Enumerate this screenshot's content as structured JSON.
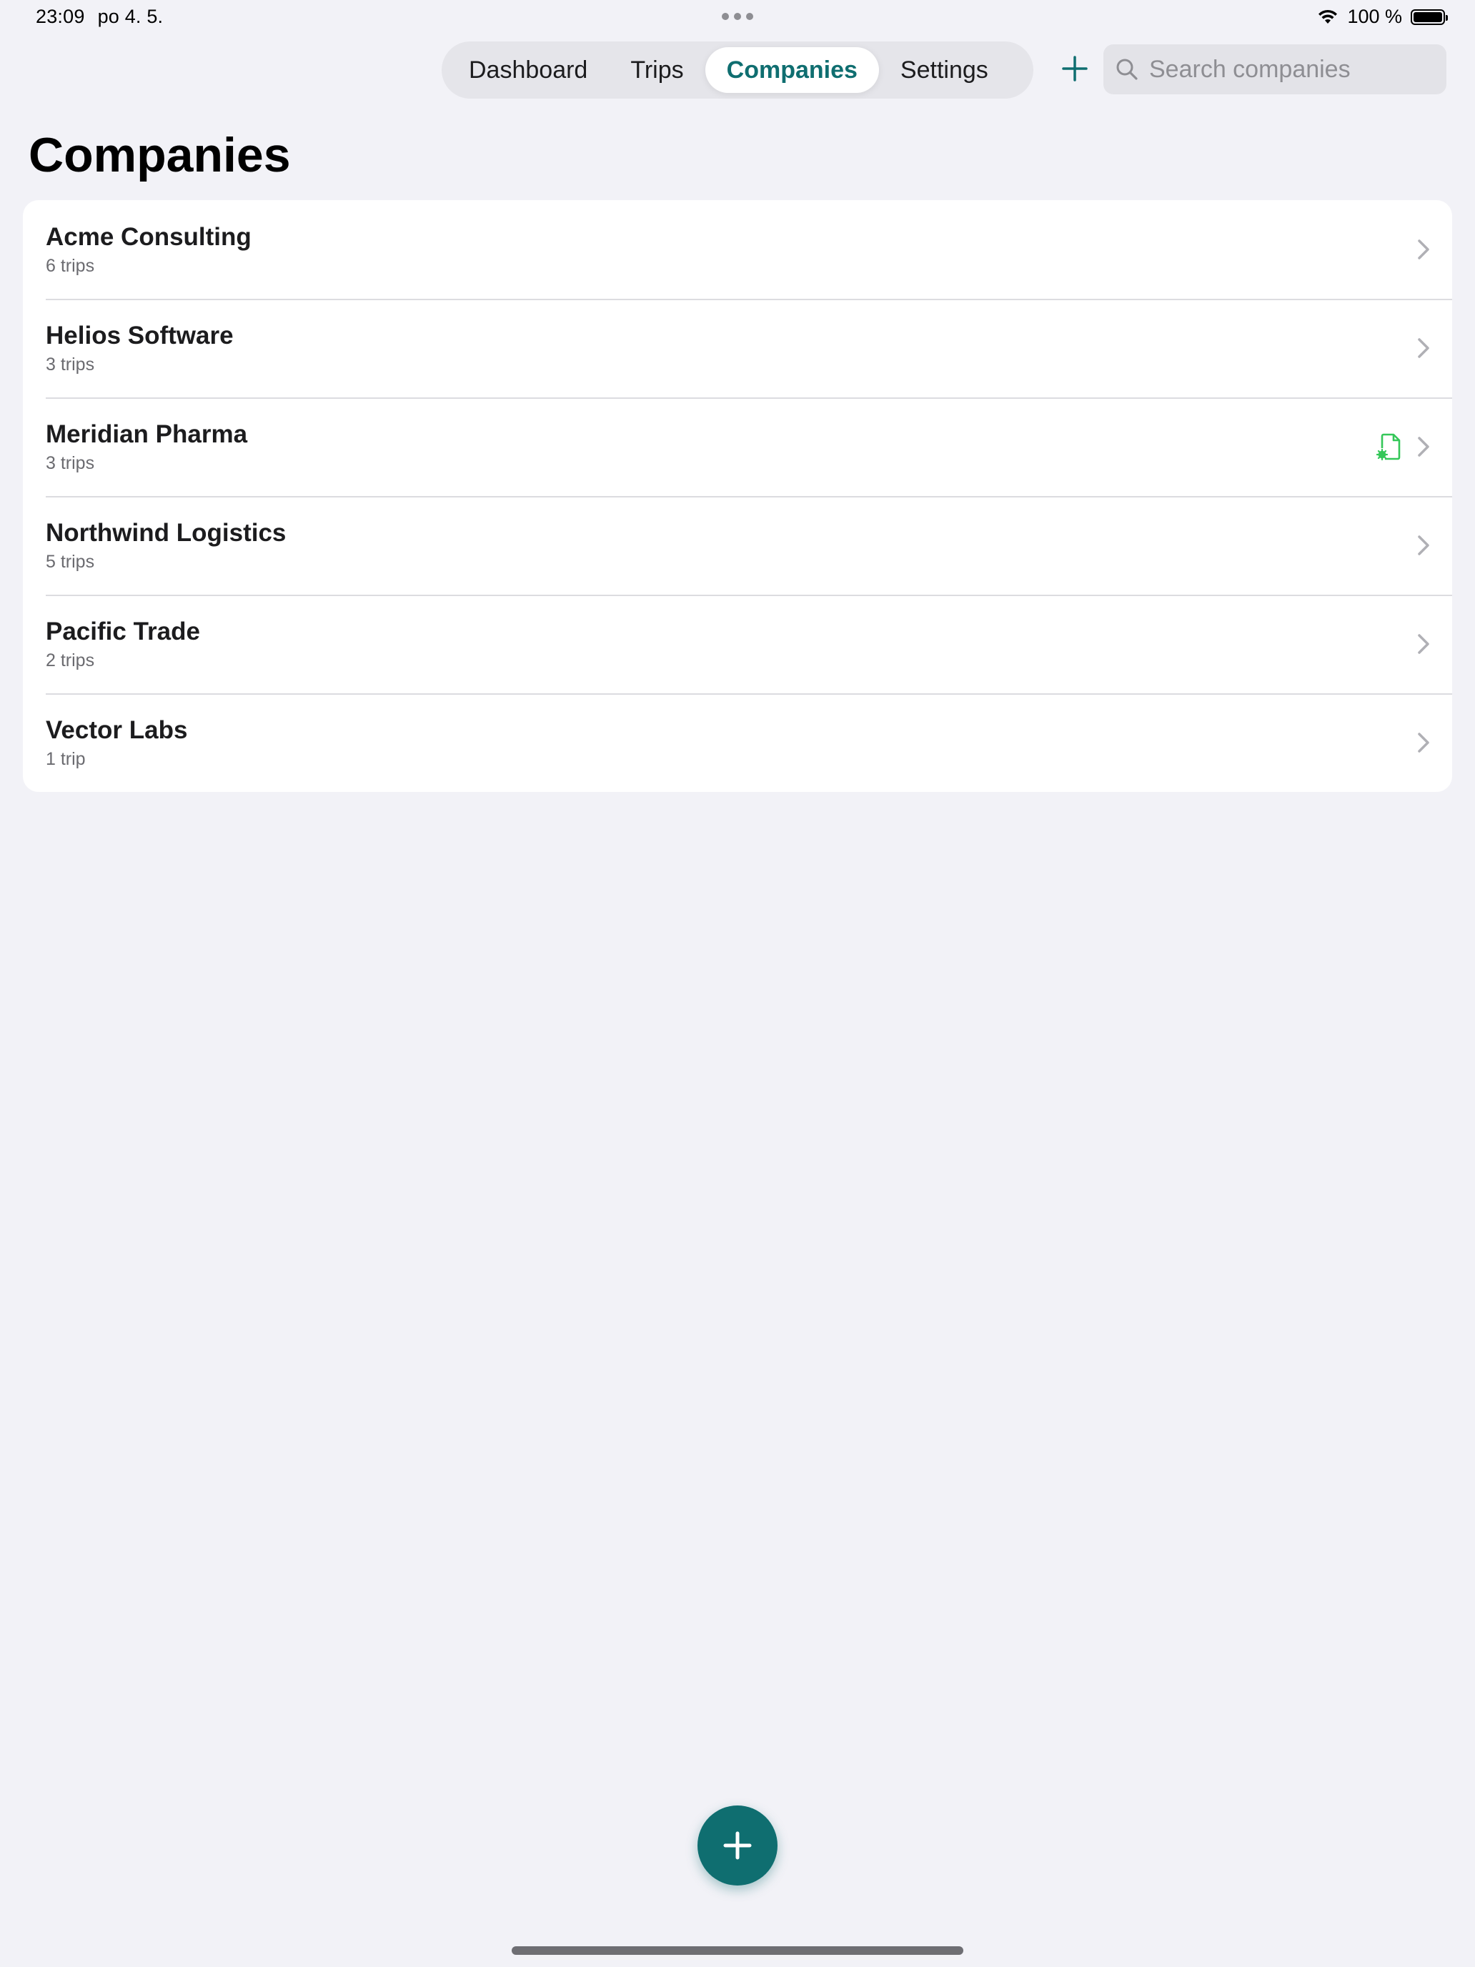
{
  "status_bar": {
    "time": "23:09",
    "date": "po 4. 5.",
    "battery_text": "100 %",
    "battery_level": 1.0
  },
  "nav": {
    "tabs": [
      {
        "label": "Dashboard",
        "active": false
      },
      {
        "label": "Trips",
        "active": false
      },
      {
        "label": "Companies",
        "active": true
      },
      {
        "label": "Settings",
        "active": false
      }
    ],
    "add_icon": "plus-icon",
    "search": {
      "placeholder": "Search companies",
      "value": "",
      "icon": "search-icon"
    }
  },
  "page": {
    "title": "Companies"
  },
  "companies": [
    {
      "name": "Acme Consulting",
      "trips": "6 trips",
      "badge": null
    },
    {
      "name": "Helios Software",
      "trips": "3 trips",
      "badge": null
    },
    {
      "name": "Meridian Pharma",
      "trips": "3 trips",
      "badge": "document-settings-icon"
    },
    {
      "name": "Northwind Logistics",
      "trips": "5 trips",
      "badge": null
    },
    {
      "name": "Pacific Trade",
      "trips": "2 trips",
      "badge": null
    },
    {
      "name": "Vector Labs",
      "trips": "1 trip",
      "badge": null
    }
  ],
  "fab": {
    "icon": "plus-icon"
  },
  "colors": {
    "accent": "#0f6e70",
    "badge_green": "#34c759",
    "background": "#f2f2f7"
  }
}
